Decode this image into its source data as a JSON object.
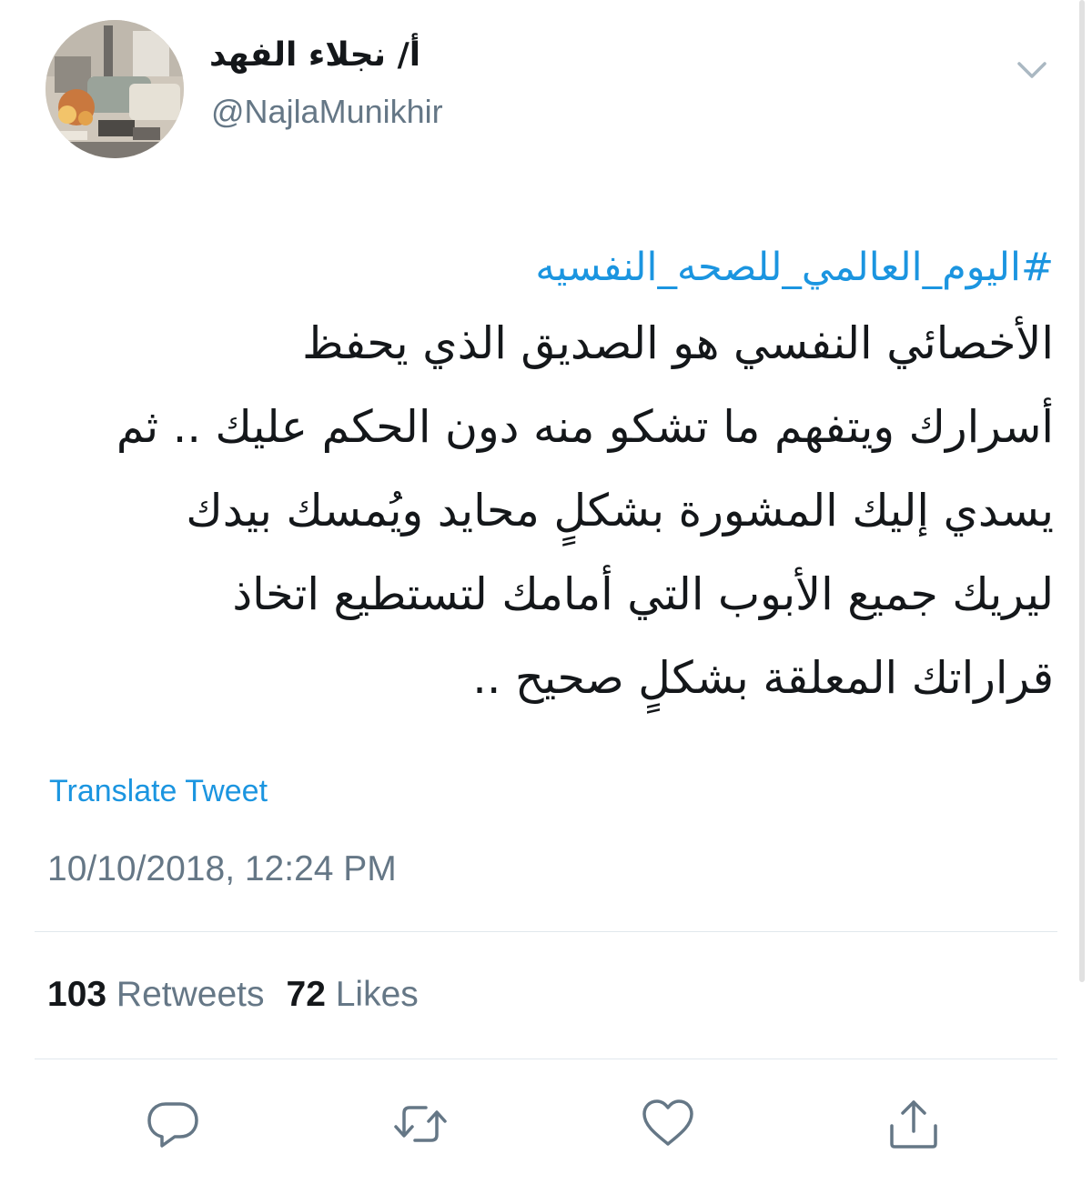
{
  "header": {
    "display_name": "أ/ نجلاء الفهد",
    "handle": "@NajlaMunikhir"
  },
  "tweet": {
    "hashtag": "#اليوم_العالمي_للصحه_النفسيه",
    "lines": [
      "الأخصائي النفسي هو الصديق الذي يحفظ",
      "أسرارك ويتفهم ما تشكو منه دون الحكم عليك .. ثم",
      "يسدي إليك المشورة بشكلٍ محايد ويُمسك بيدك",
      "ليريك جميع الأبوب التي أمامك لتستطيع اتخاذ",
      "قراراتك المعلقة بشكلٍ صحيح .."
    ],
    "translate_label": "Translate Tweet",
    "timestamp": "10/10/2018, 12:24 PM"
  },
  "stats": {
    "retweets_count": "103",
    "retweets_label": "Retweets",
    "likes_count": "72",
    "likes_label": "Likes"
  },
  "icons": {
    "caret": "chevron-down-icon",
    "reply": "reply-icon",
    "retweet": "retweet-icon",
    "like": "heart-icon",
    "share": "share-icon"
  },
  "colors": {
    "link": "#1b95e0",
    "secondary_text": "#657786",
    "primary_text": "#14171a",
    "divider": "#e1e8ed"
  }
}
